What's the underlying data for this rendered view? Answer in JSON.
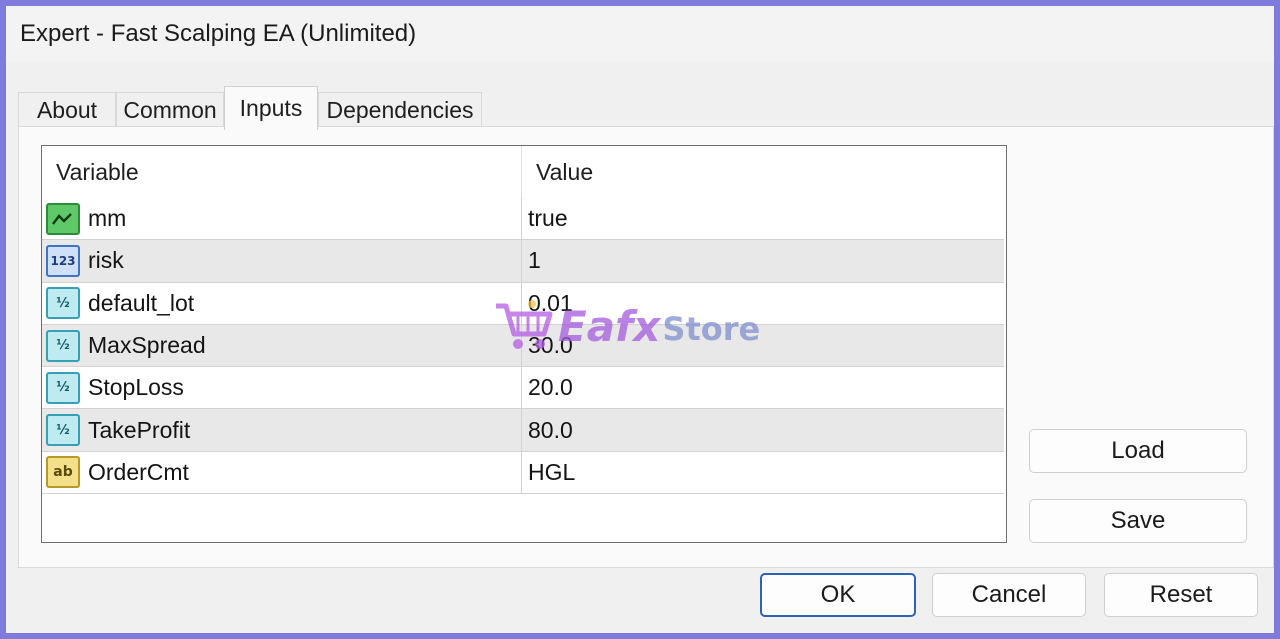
{
  "window": {
    "title": "Expert - Fast Scalping EA (Unlimited)"
  },
  "tabs": [
    {
      "label": "About",
      "active": false
    },
    {
      "label": "Common",
      "active": false
    },
    {
      "label": "Inputs",
      "active": true
    },
    {
      "label": "Dependencies",
      "active": false
    }
  ],
  "grid": {
    "headers": {
      "variable": "Variable",
      "value": "Value"
    },
    "rows": [
      {
        "icon": "bool-icon",
        "variable": "mm",
        "value": "true"
      },
      {
        "icon": "int-icon",
        "variable": "risk",
        "value": "1"
      },
      {
        "icon": "double-icon",
        "variable": "default_lot",
        "value": "0.01"
      },
      {
        "icon": "double-icon",
        "variable": "MaxSpread",
        "value": "30.0"
      },
      {
        "icon": "double-icon",
        "variable": "StopLoss",
        "value": "20.0"
      },
      {
        "icon": "double-icon",
        "variable": "TakeProfit",
        "value": "80.0"
      },
      {
        "icon": "string-icon",
        "variable": "OrderCmt",
        "value": "HGL"
      }
    ]
  },
  "icon_glyphs": {
    "int": "123",
    "dbl": "½",
    "str": "ab"
  },
  "side_buttons": {
    "load": "Load",
    "save": "Save"
  },
  "footer": {
    "ok": "OK",
    "cancel": "Cancel",
    "reset": "Reset"
  },
  "watermark": {
    "brand": "Eafx",
    "suffix": "Store"
  },
  "colors": {
    "frame": "#7f7bdc",
    "primary_border": "#2d62b8",
    "alt_row": "#e8e8e8"
  }
}
